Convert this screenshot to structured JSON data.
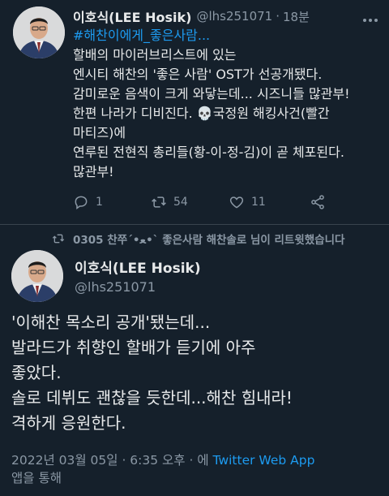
{
  "tweet1": {
    "display_name": "이호식(LEE Hosik)",
    "handle": "@lhs251071",
    "separator": "·",
    "time": "18분",
    "hashtag": "#해찬이에게_좋은사람...",
    "lines": [
      "할배의 마이러브리스트에 있는",
      "엔시티 해찬의 '좋은 사람' OST가 선공개됐다.",
      "감미로운 음색이 크게 와닿는데... 시즈니들 많관부!",
      "한편 나라가 디비진다.",
      "국정원 해킹사건(빨간",
      "마티즈)에",
      "연루된 전현직 총리들(황-이-정-김)이 곧 체포된다.",
      "많관부!"
    ],
    "skull": "💀",
    "replies": "1",
    "retweets": "54",
    "likes": "11"
  },
  "retweet_note": "0305 찬쭈´•ﻌ•` 좋은사람 해찬솔로 님이 리트윗했습니다",
  "tweet2": {
    "display_name": "이호식(LEE Hosik)",
    "handle": "@lhs251071",
    "lines": [
      "'이해찬 목소리 공개'됐는데...",
      "발라드가 취향인 할배가 듣기에 아주",
      "좋았다.",
      "솔로 데뷔도 괜찮을 듯한데...해찬 힘내라!",
      "격하게 응원한다."
    ],
    "date_time": "2022년 03월 05일 · 6:35 오후 · 에",
    "app": "Twitter Web App",
    "via": "앱을 통해"
  },
  "colors": {
    "background": "#15202b",
    "text": "#e7e9ea",
    "muted": "#8b98a5",
    "link": "#1d9bf0"
  },
  "icons": [
    "reply-icon",
    "retweet-icon",
    "like-icon",
    "share-icon",
    "more-icon"
  ]
}
